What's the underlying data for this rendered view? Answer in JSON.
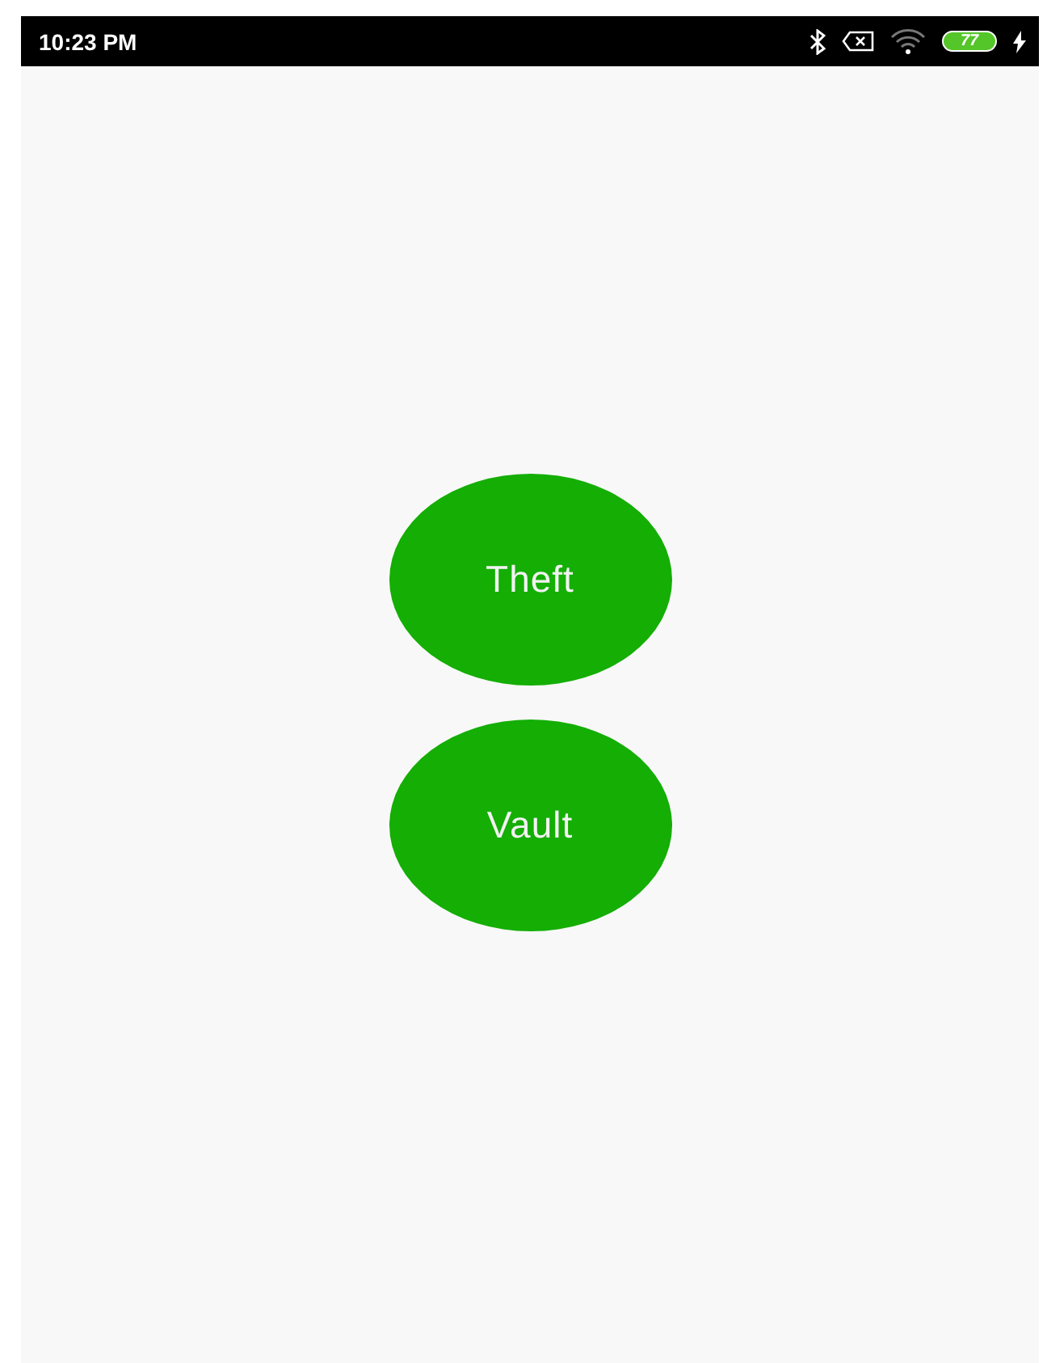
{
  "status_bar": {
    "time": "10:23 PM",
    "battery": "77"
  },
  "buttons": [
    {
      "label": "Theft"
    },
    {
      "label": "Vault"
    }
  ]
}
